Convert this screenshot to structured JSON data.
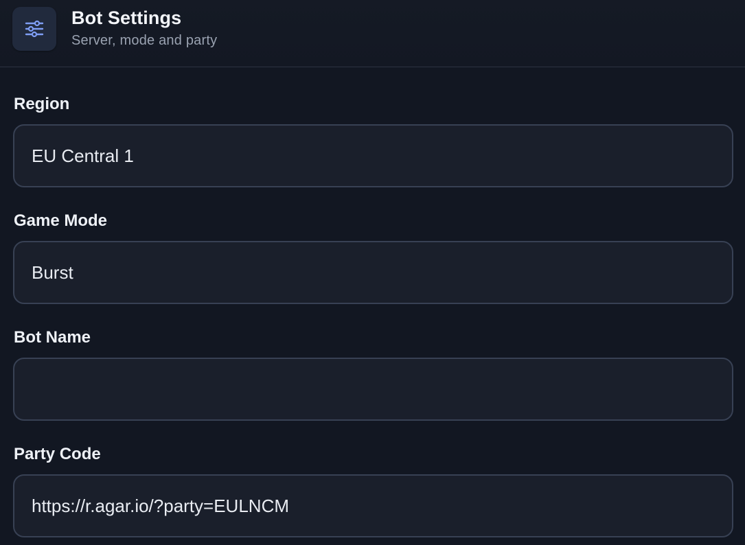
{
  "header": {
    "title": "Bot Settings",
    "subtitle": "Server, mode and party",
    "icon": "sliders-icon",
    "accent_color": "#7f9ef5"
  },
  "fields": [
    {
      "label": "Region",
      "value": "EU Central 1"
    },
    {
      "label": "Game Mode",
      "value": "Burst"
    },
    {
      "label": "Bot Name",
      "value": ""
    },
    {
      "label": "Party Code",
      "value": "https://r.agar.io/?party=EULNCM"
    }
  ]
}
